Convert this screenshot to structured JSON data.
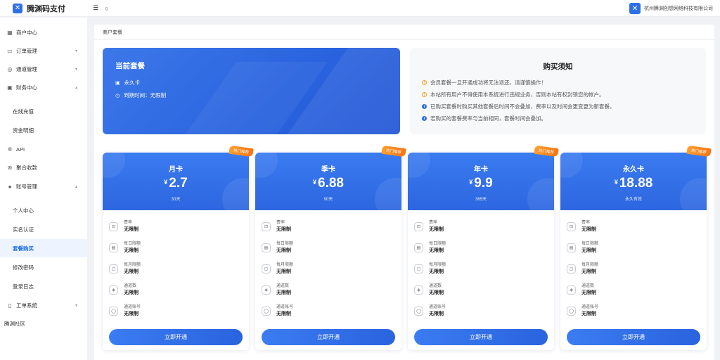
{
  "header": {
    "brand": "腾渊码支付",
    "brand_icon": "腾渊-logo",
    "company": "杭州腾渊创想网络科技有限公司"
  },
  "sidebar": {
    "items": [
      {
        "label": "商户中心",
        "icon": "grid-icon"
      },
      {
        "label": "订单管理",
        "icon": "cart-icon",
        "chevron": "▾"
      },
      {
        "label": "通道管理",
        "icon": "channel-icon",
        "chevron": "▾"
      },
      {
        "label": "财务中心",
        "icon": "finance-icon",
        "chevron": "▴"
      },
      {
        "label": "在线充值",
        "sub": true
      },
      {
        "label": "资金明细",
        "sub": true
      },
      {
        "label": "API",
        "icon": "api-icon"
      },
      {
        "label": "聚合收款",
        "icon": "collect-icon"
      },
      {
        "label": "账号管理",
        "icon": "user-icon",
        "chevron": "▴"
      },
      {
        "label": "个人中心",
        "sub": true
      },
      {
        "label": "实名认证",
        "sub": true
      },
      {
        "label": "套餐购买",
        "sub": true,
        "active": true
      },
      {
        "label": "修改密码",
        "sub": true
      },
      {
        "label": "登录日志",
        "sub": true
      },
      {
        "label": "工单系统",
        "icon": "ticket-icon",
        "chevron": "▾"
      },
      {
        "label": "腾渊社区"
      }
    ]
  },
  "breadcrumb": "商户套餐",
  "current_plan": {
    "title": "当前套餐",
    "name": "永久卡",
    "expire": "到期时间：无限制"
  },
  "notice": {
    "title": "购买须知",
    "items": [
      {
        "text": "会员套餐一旦开通成功将无法退还，请谨慎操作！",
        "type": "warn"
      },
      {
        "text": "本站所有用户不得使用本系统进行违规业务，否则本站有权封锁您的帐户。",
        "type": "warn"
      },
      {
        "text": "已购买套餐时购买其他套餐后时间不会叠加，费率以及时间会更变更为新套餐。",
        "type": "info"
      },
      {
        "text": "若购买的套餐费率与当前相同，套餐时间会叠加。",
        "type": "info"
      }
    ]
  },
  "plans": [
    {
      "name": "月卡",
      "currency": "¥",
      "price": "2.7",
      "duration": "30天",
      "badge": "热门推荐",
      "features": [
        {
          "label": "费率",
          "value": "无限制"
        },
        {
          "label": "每日限额",
          "value": "无限制"
        },
        {
          "label": "每月限额",
          "value": "无限制"
        },
        {
          "label": "通道数",
          "value": "无限制"
        },
        {
          "label": "通道账号",
          "value": "无限制"
        }
      ],
      "button": "立即开通"
    },
    {
      "name": "季卡",
      "currency": "¥",
      "price": "6.88",
      "duration": "90天",
      "badge": "热门推荐",
      "features": [
        {
          "label": "费率",
          "value": "无限制"
        },
        {
          "label": "每日限额",
          "value": "无限制"
        },
        {
          "label": "每月限额",
          "value": "无限制"
        },
        {
          "label": "通道数",
          "value": "无限制"
        },
        {
          "label": "通道账号",
          "value": "无限制"
        }
      ],
      "button": "立即开通"
    },
    {
      "name": "年卡",
      "currency": "¥",
      "price": "9.9",
      "duration": "365天",
      "badge": "热门推荐",
      "features": [
        {
          "label": "费率",
          "value": "无限制"
        },
        {
          "label": "每日限额",
          "value": "无限制"
        },
        {
          "label": "每月限额",
          "value": "无限制"
        },
        {
          "label": "通道数",
          "value": "无限制"
        },
        {
          "label": "通道账号",
          "value": "无限制"
        }
      ],
      "button": "立即开通"
    },
    {
      "name": "永久卡",
      "currency": "¥",
      "price": "18.88",
      "duration": "永久有效",
      "badge": "热门推荐",
      "features": [
        {
          "label": "费率",
          "value": "无限制"
        },
        {
          "label": "每日限额",
          "value": "无限制"
        },
        {
          "label": "每月限额",
          "value": "无限制"
        },
        {
          "label": "通道数",
          "value": "无限制"
        },
        {
          "label": "通道账号",
          "value": "无限制"
        }
      ],
      "button": "立即开通"
    }
  ],
  "colors": {
    "accent": "#2f6fe6",
    "badge": "#f57414",
    "active_bg": "#eef4ff"
  }
}
